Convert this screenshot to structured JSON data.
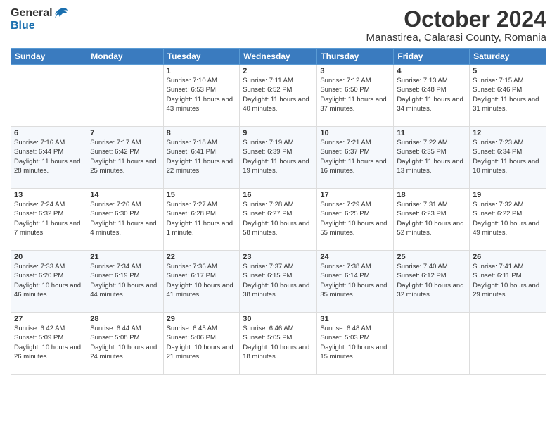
{
  "logo": {
    "general": "General",
    "blue": "Blue"
  },
  "title": "October 2024",
  "location": "Manastirea, Calarasi County, Romania",
  "headers": [
    "Sunday",
    "Monday",
    "Tuesday",
    "Wednesday",
    "Thursday",
    "Friday",
    "Saturday"
  ],
  "weeks": [
    [
      {
        "day": "",
        "info": ""
      },
      {
        "day": "",
        "info": ""
      },
      {
        "day": "1",
        "info": "Sunrise: 7:10 AM\nSunset: 6:53 PM\nDaylight: 11 hours and 43 minutes."
      },
      {
        "day": "2",
        "info": "Sunrise: 7:11 AM\nSunset: 6:52 PM\nDaylight: 11 hours and 40 minutes."
      },
      {
        "day": "3",
        "info": "Sunrise: 7:12 AM\nSunset: 6:50 PM\nDaylight: 11 hours and 37 minutes."
      },
      {
        "day": "4",
        "info": "Sunrise: 7:13 AM\nSunset: 6:48 PM\nDaylight: 11 hours and 34 minutes."
      },
      {
        "day": "5",
        "info": "Sunrise: 7:15 AM\nSunset: 6:46 PM\nDaylight: 11 hours and 31 minutes."
      }
    ],
    [
      {
        "day": "6",
        "info": "Sunrise: 7:16 AM\nSunset: 6:44 PM\nDaylight: 11 hours and 28 minutes."
      },
      {
        "day": "7",
        "info": "Sunrise: 7:17 AM\nSunset: 6:42 PM\nDaylight: 11 hours and 25 minutes."
      },
      {
        "day": "8",
        "info": "Sunrise: 7:18 AM\nSunset: 6:41 PM\nDaylight: 11 hours and 22 minutes."
      },
      {
        "day": "9",
        "info": "Sunrise: 7:19 AM\nSunset: 6:39 PM\nDaylight: 11 hours and 19 minutes."
      },
      {
        "day": "10",
        "info": "Sunrise: 7:21 AM\nSunset: 6:37 PM\nDaylight: 11 hours and 16 minutes."
      },
      {
        "day": "11",
        "info": "Sunrise: 7:22 AM\nSunset: 6:35 PM\nDaylight: 11 hours and 13 minutes."
      },
      {
        "day": "12",
        "info": "Sunrise: 7:23 AM\nSunset: 6:34 PM\nDaylight: 11 hours and 10 minutes."
      }
    ],
    [
      {
        "day": "13",
        "info": "Sunrise: 7:24 AM\nSunset: 6:32 PM\nDaylight: 11 hours and 7 minutes."
      },
      {
        "day": "14",
        "info": "Sunrise: 7:26 AM\nSunset: 6:30 PM\nDaylight: 11 hours and 4 minutes."
      },
      {
        "day": "15",
        "info": "Sunrise: 7:27 AM\nSunset: 6:28 PM\nDaylight: 11 hours and 1 minute."
      },
      {
        "day": "16",
        "info": "Sunrise: 7:28 AM\nSunset: 6:27 PM\nDaylight: 10 hours and 58 minutes."
      },
      {
        "day": "17",
        "info": "Sunrise: 7:29 AM\nSunset: 6:25 PM\nDaylight: 10 hours and 55 minutes."
      },
      {
        "day": "18",
        "info": "Sunrise: 7:31 AM\nSunset: 6:23 PM\nDaylight: 10 hours and 52 minutes."
      },
      {
        "day": "19",
        "info": "Sunrise: 7:32 AM\nSunset: 6:22 PM\nDaylight: 10 hours and 49 minutes."
      }
    ],
    [
      {
        "day": "20",
        "info": "Sunrise: 7:33 AM\nSunset: 6:20 PM\nDaylight: 10 hours and 46 minutes."
      },
      {
        "day": "21",
        "info": "Sunrise: 7:34 AM\nSunset: 6:19 PM\nDaylight: 10 hours and 44 minutes."
      },
      {
        "day": "22",
        "info": "Sunrise: 7:36 AM\nSunset: 6:17 PM\nDaylight: 10 hours and 41 minutes."
      },
      {
        "day": "23",
        "info": "Sunrise: 7:37 AM\nSunset: 6:15 PM\nDaylight: 10 hours and 38 minutes."
      },
      {
        "day": "24",
        "info": "Sunrise: 7:38 AM\nSunset: 6:14 PM\nDaylight: 10 hours and 35 minutes."
      },
      {
        "day": "25",
        "info": "Sunrise: 7:40 AM\nSunset: 6:12 PM\nDaylight: 10 hours and 32 minutes."
      },
      {
        "day": "26",
        "info": "Sunrise: 7:41 AM\nSunset: 6:11 PM\nDaylight: 10 hours and 29 minutes."
      }
    ],
    [
      {
        "day": "27",
        "info": "Sunrise: 6:42 AM\nSunset: 5:09 PM\nDaylight: 10 hours and 26 minutes."
      },
      {
        "day": "28",
        "info": "Sunrise: 6:44 AM\nSunset: 5:08 PM\nDaylight: 10 hours and 24 minutes."
      },
      {
        "day": "29",
        "info": "Sunrise: 6:45 AM\nSunset: 5:06 PM\nDaylight: 10 hours and 21 minutes."
      },
      {
        "day": "30",
        "info": "Sunrise: 6:46 AM\nSunset: 5:05 PM\nDaylight: 10 hours and 18 minutes."
      },
      {
        "day": "31",
        "info": "Sunrise: 6:48 AM\nSunset: 5:03 PM\nDaylight: 10 hours and 15 minutes."
      },
      {
        "day": "",
        "info": ""
      },
      {
        "day": "",
        "info": ""
      }
    ]
  ]
}
